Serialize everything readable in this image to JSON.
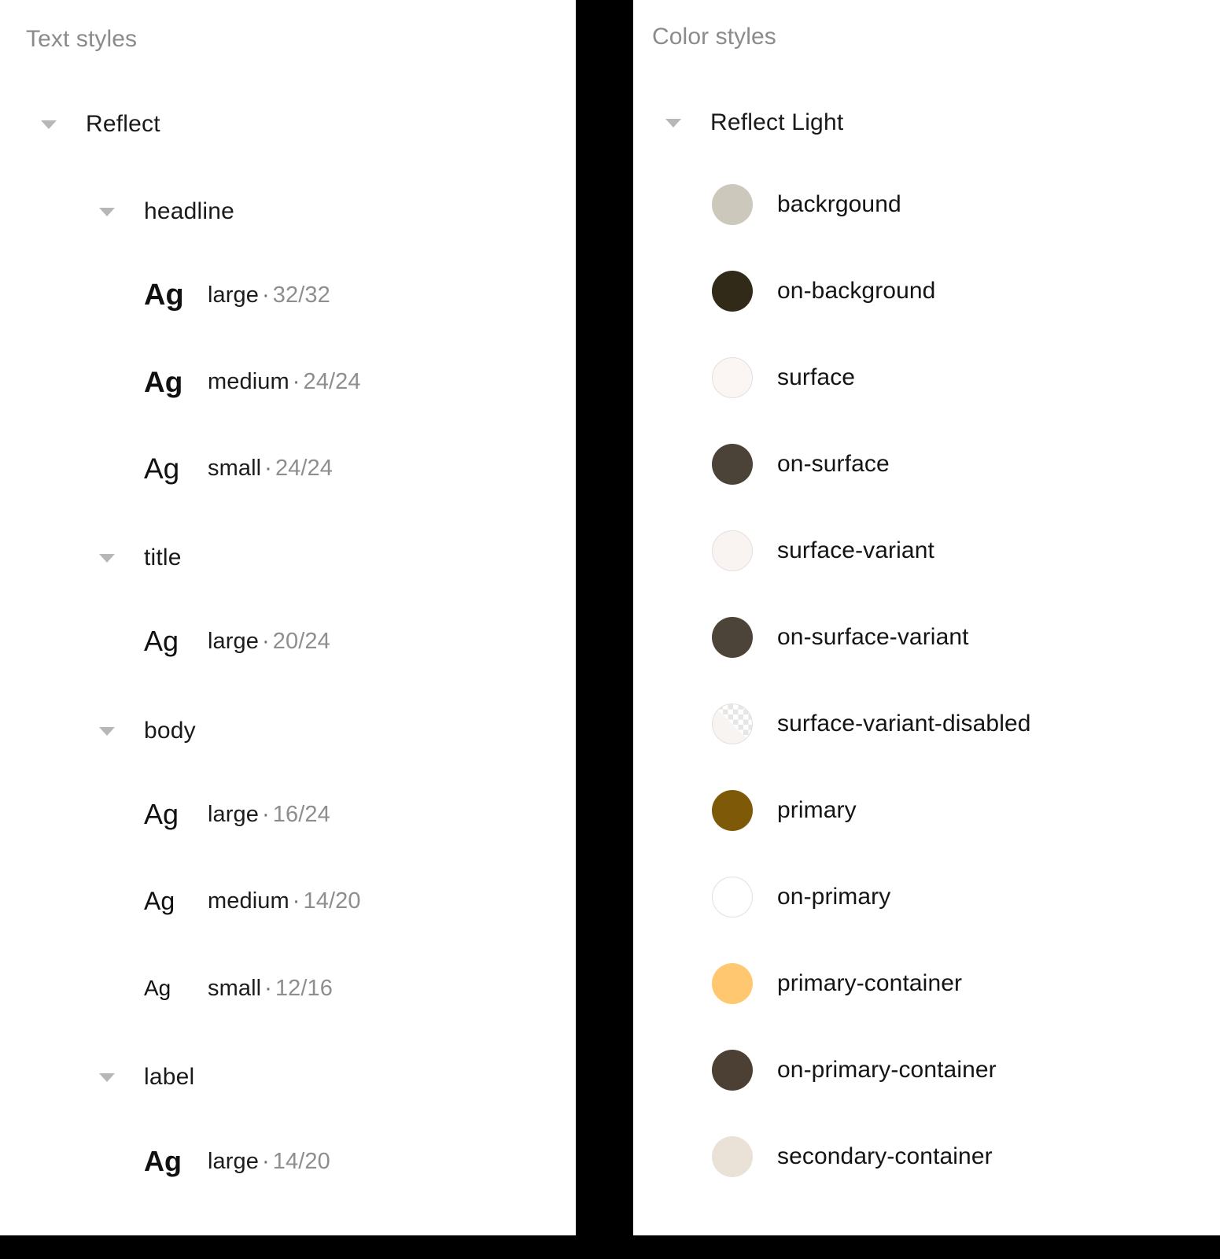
{
  "canvas": {
    "background": "#000000",
    "panel_background": "#ffffff"
  },
  "text_panel": {
    "title": "Text styles",
    "root": {
      "label": "Reflect",
      "caret": "chevron-down-icon"
    },
    "groups": [
      {
        "label": "headline",
        "styles": [
          {
            "preview": "Ag",
            "name": "large",
            "separator": "·",
            "sizes": "32/32"
          },
          {
            "preview": "Ag",
            "name": "medium",
            "separator": "·",
            "sizes": "24/24"
          },
          {
            "preview": "Ag",
            "name": "small",
            "separator": "·",
            "sizes": "24/24"
          }
        ]
      },
      {
        "label": "title",
        "styles": [
          {
            "preview": "Ag",
            "name": "large",
            "separator": "·",
            "sizes": "20/24"
          }
        ]
      },
      {
        "label": "body",
        "styles": [
          {
            "preview": "Ag",
            "name": "large",
            "separator": "·",
            "sizes": "16/24"
          },
          {
            "preview": "Ag",
            "name": "medium",
            "separator": "·",
            "sizes": "14/20"
          },
          {
            "preview": "Ag",
            "name": "small",
            "separator": "·",
            "sizes": "12/16"
          }
        ]
      },
      {
        "label": "label",
        "styles": [
          {
            "preview": "Ag",
            "name": "large",
            "separator": "·",
            "sizes": "14/20"
          }
        ]
      }
    ]
  },
  "color_panel": {
    "title": "Color styles",
    "root": {
      "label": "Reflect Light",
      "caret": "chevron-down-icon"
    },
    "colors": [
      {
        "label": "backrgound",
        "hex": "#CDC8BC"
      },
      {
        "label": "on-background",
        "hex": "#312A18"
      },
      {
        "label": "surface",
        "hex": "#FBF6F3"
      },
      {
        "label": "on-surface",
        "hex": "#4B4238"
      },
      {
        "label": "surface-variant",
        "hex": "#F9F4F1"
      },
      {
        "label": "on-surface-variant",
        "hex": "#4C4339"
      },
      {
        "label": "surface-variant-disabled",
        "hex": "#F7F4F1"
      },
      {
        "label": "primary",
        "hex": "#7E5A08"
      },
      {
        "label": "on-primary",
        "hex": "#FFFFFF"
      },
      {
        "label": "primary-container",
        "hex": "#FFC870"
      },
      {
        "label": "on-primary-container",
        "hex": "#4C4035"
      },
      {
        "label": "secondary-container",
        "hex": "#EAE1D7"
      }
    ]
  }
}
